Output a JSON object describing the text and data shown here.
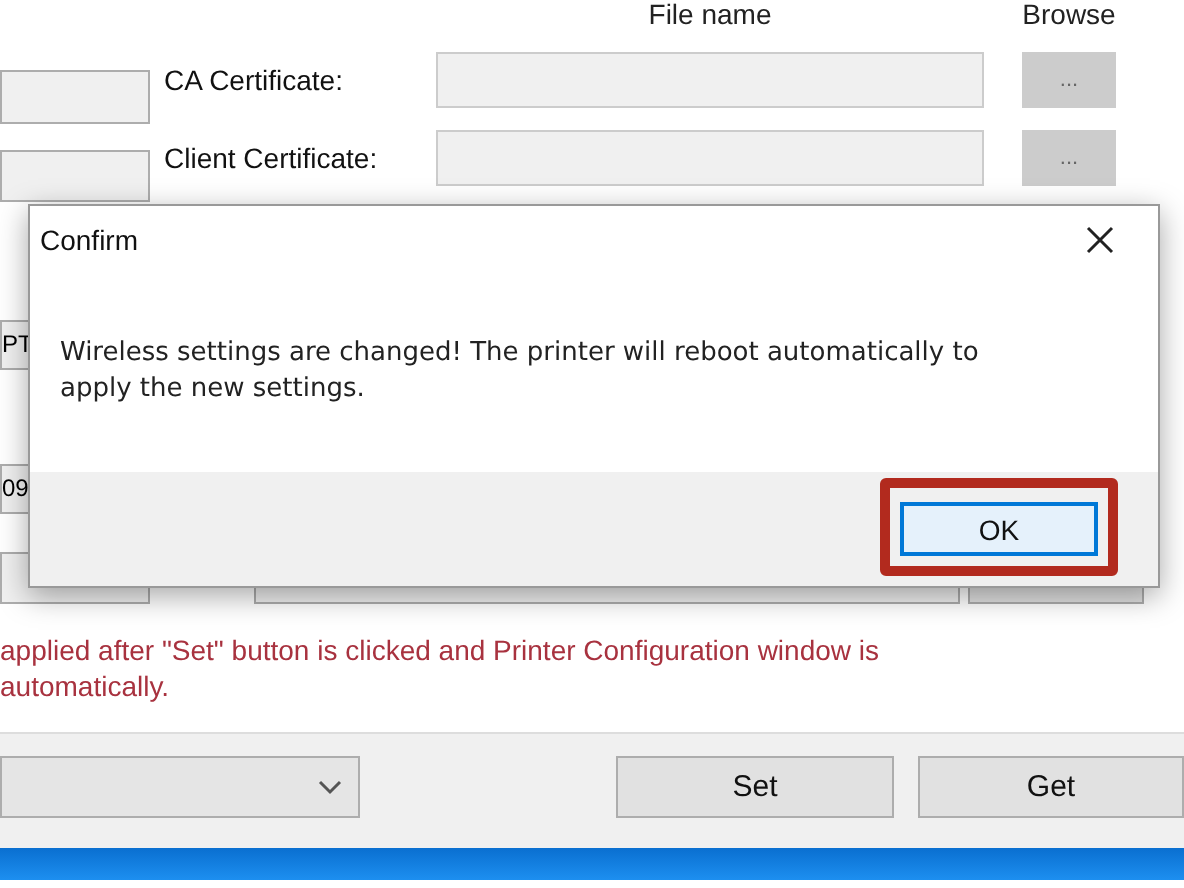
{
  "background": {
    "columns": [
      "File name",
      "Browse"
    ],
    "certificates": [
      {
        "label": "CA Certificate:",
        "browse": "..."
      },
      {
        "label": "Client Certificate:",
        "browse": "..."
      }
    ],
    "left_field_values": [
      "PT",
      "09"
    ],
    "note": "applied after \"Set\" button is clicked and Printer Configuration window is automatically.",
    "buttons": [
      "Set",
      "Get"
    ]
  },
  "dialog": {
    "title": "Confirm",
    "message": "Wireless settings are changed! The printer will reboot automatically to apply the new settings.",
    "buttons": [
      {
        "label": "OK",
        "focused": true,
        "highlighted": true
      }
    ]
  }
}
